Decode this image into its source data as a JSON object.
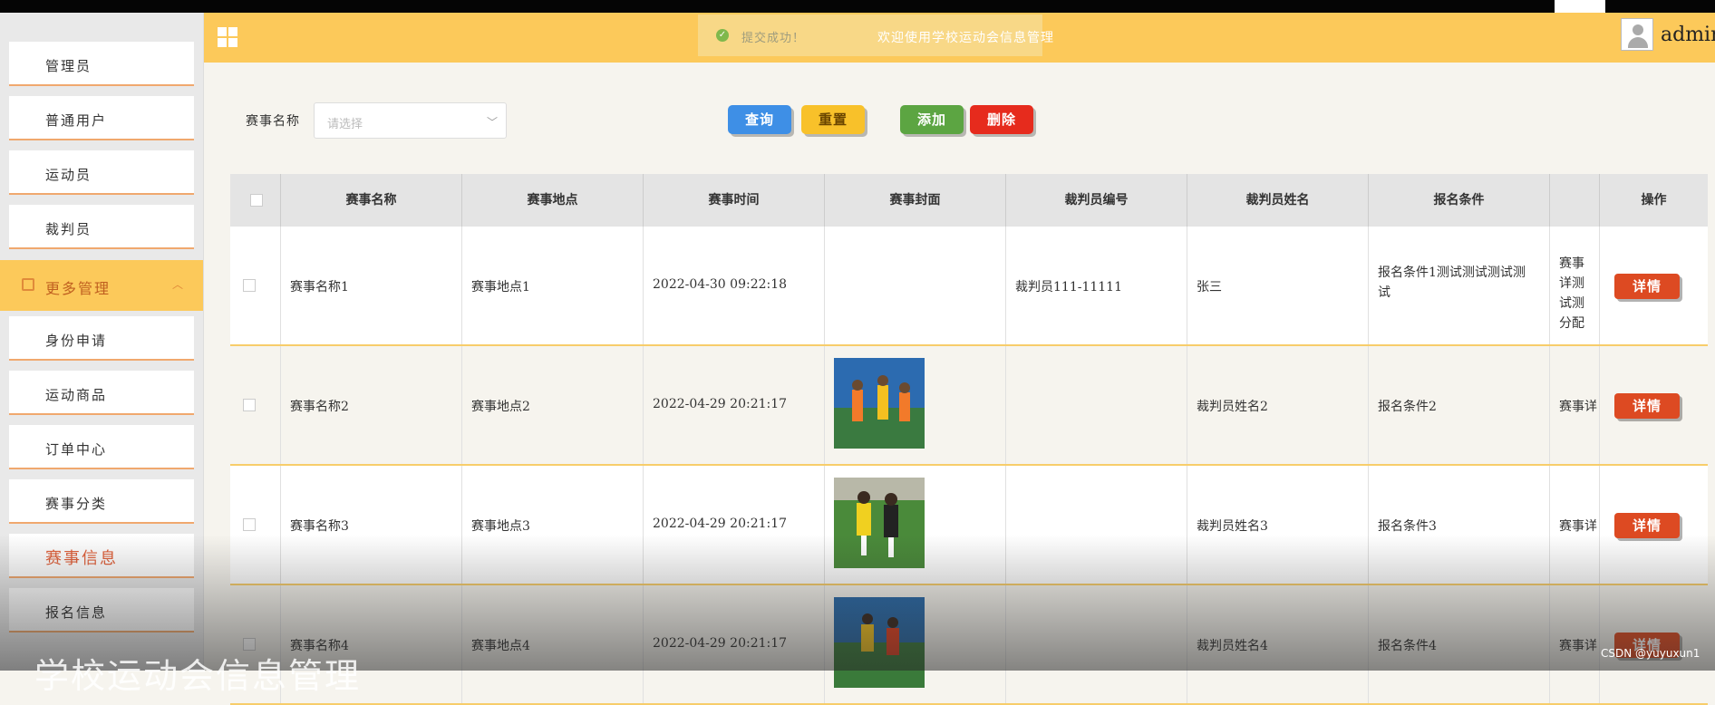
{
  "header": {
    "toast": "提交成功！",
    "welcome": "欢迎使用学校运动会信息管理",
    "username": "admin"
  },
  "sidebar": {
    "items_top": [
      "管理员",
      "普通用户",
      "运动员",
      "裁判员"
    ],
    "group_label": "更多管理",
    "items_bottom": [
      "身份申请",
      "运动商品",
      "订单中心",
      "赛事分类",
      "赛事信息",
      "报名信息"
    ],
    "active": "赛事信息"
  },
  "filter": {
    "label": "赛事名称",
    "placeholder": "请选择"
  },
  "buttons": {
    "search": "查询",
    "reset": "重置",
    "add": "添加",
    "delete": "删除"
  },
  "table": {
    "columns": [
      "赛事名称",
      "赛事地点",
      "赛事时间",
      "赛事封面",
      "裁判员编号",
      "裁判员姓名",
      "报名条件",
      "",
      "操作"
    ],
    "rows": [
      {
        "name": "赛事名称1",
        "location": "赛事地点1",
        "time": "2022-04-30 09:22:18",
        "referee_no": "裁判员111-11111",
        "referee_name": "张三",
        "condition": "报名条件1测试测试测试测试",
        "extra": "赛事详测试测分配",
        "action": "详情",
        "cover": "none"
      },
      {
        "name": "赛事名称2",
        "location": "赛事地点2",
        "time": "2022-04-29 20:21:17",
        "referee_no": "",
        "referee_name": "裁判员姓名2",
        "condition": "报名条件2",
        "extra": "赛事详",
        "action": "详情",
        "cover": "running-photo"
      },
      {
        "name": "赛事名称3",
        "location": "赛事地点3",
        "time": "2022-04-29 20:21:17",
        "referee_no": "",
        "referee_name": "裁判员姓名3",
        "condition": "报名条件3",
        "extra": "赛事详",
        "action": "详情",
        "cover": "hockey-photo"
      },
      {
        "name": "赛事名称4",
        "location": "赛事地点4",
        "time": "2022-04-29 20:21:17",
        "referee_no": "",
        "referee_name": "裁判员姓名4",
        "condition": "报名条件4",
        "extra": "赛事详",
        "action": "详情",
        "cover": "hockey-photo-2"
      }
    ]
  },
  "overlay": {
    "subtitle": "学校运动会信息管理",
    "watermark": "CSDN @yuyuxun1"
  }
}
